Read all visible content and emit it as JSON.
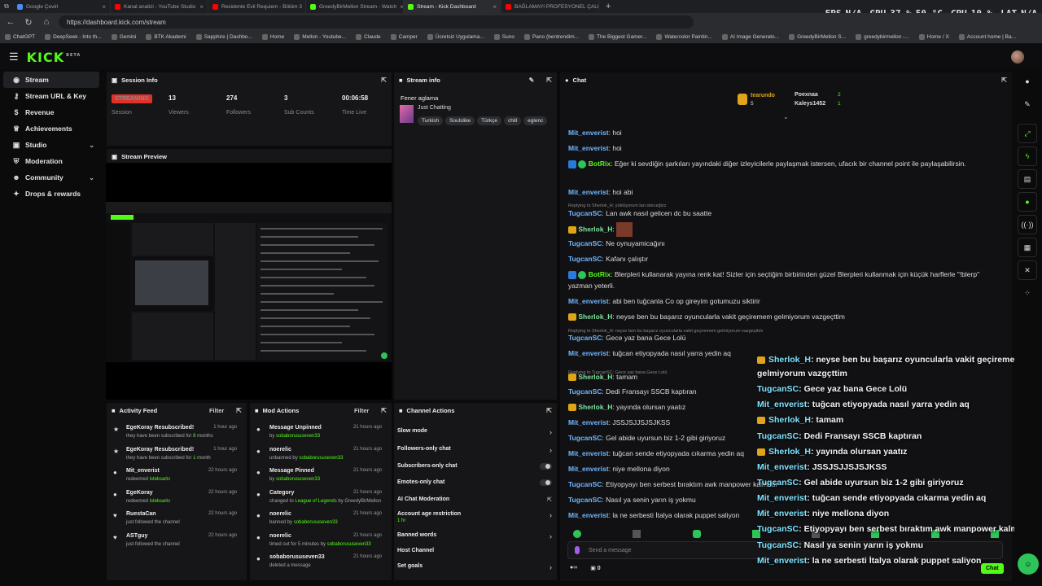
{
  "browser": {
    "tabs": [
      {
        "title": "Google Çeviri",
        "color": "#4a8cf7",
        "active": false
      },
      {
        "title": "Kanal analizi - YouTube Studio",
        "color": "#ff0000",
        "active": false
      },
      {
        "title": "Residente Evil Requiem - Bölüm 3",
        "color": "#ff0000",
        "active": false
      },
      {
        "title": "GreedyBirMellon Stream - Watch",
        "color": "#53fc18",
        "active": false
      },
      {
        "title": "Stream - Kick Dashboard",
        "color": "#53fc18",
        "active": true
      },
      {
        "title": "BAĞLAMAYI PROFESYONEL ÇALMAK",
        "color": "#ff0000",
        "active": false
      }
    ],
    "url": "https://dashboard.kick.com/stream",
    "bookmarks": [
      "ChatGPT",
      "DeepSeek - Into th...",
      "Gemini",
      "BTK Akademi",
      "Sapphire | Dashbo...",
      "Home",
      "Mellon - Youtube...",
      "Claude",
      "Camper",
      "Ücretsiz Uygulama...",
      "Suno",
      "Pano (bentrendim...",
      "The Biggest Gamer...",
      "Watercolor Paintin...",
      "AI Image Generato...",
      "GreedyBirMellon S...",
      "greedybirmellon -...",
      "Home / X",
      "Account home | Ba..."
    ]
  },
  "hud": {
    "fps_label": "FPS",
    "fps": "N/A",
    "gpu_label": "GPU",
    "gpu": "37 %",
    "gpu_temp": "50 °C",
    "cpu_label": "CPU",
    "cpu": "10 %",
    "lat_label": "LAT",
    "lat": "N/A"
  },
  "kick": {
    "logo": "KICK",
    "logo_sup": "BETA"
  },
  "sidebar": {
    "items": [
      {
        "label": "Stream",
        "icon": "broadcast-icon"
      },
      {
        "label": "Stream URL & Key",
        "icon": "key-icon"
      },
      {
        "label": "Revenue",
        "icon": "money-icon"
      },
      {
        "label": "Achievements",
        "icon": "trophy-icon"
      },
      {
        "label": "Studio",
        "icon": "studio-icon"
      },
      {
        "label": "Moderation",
        "icon": "shield-icon"
      },
      {
        "label": "Community",
        "icon": "people-icon"
      },
      {
        "label": "Drops & rewards",
        "icon": "gift-icon"
      }
    ]
  },
  "session": {
    "title": "Session Info",
    "status": "STREAMING",
    "status_label": "Session",
    "stats": [
      {
        "value": "13",
        "label": "Viewers"
      },
      {
        "value": "274",
        "label": "Followers"
      },
      {
        "value": "3",
        "label": "Sub Counts"
      },
      {
        "value": "00:06:58",
        "label": "Time Live"
      }
    ]
  },
  "stream_info": {
    "title": "Stream info",
    "stream_title": "Fener aglama",
    "category": "Just Chatting",
    "tags": [
      "Turkish",
      "Soulslike",
      "Türkçe",
      "chill",
      "eglenc"
    ]
  },
  "preview": {
    "title": "Stream Preview"
  },
  "activity": {
    "title": "Activity Feed",
    "filter": "Filter",
    "items": [
      {
        "title": "EgeKoray Resubscribed!",
        "sub": "they have been subscribed for ",
        "hl": "8",
        "sub2": " months",
        "time": "1 hour ago"
      },
      {
        "title": "EgeKoray Resubscribed!",
        "sub": "they have been subscribed for ",
        "hl": "1",
        "sub2": " month",
        "time": "1 hour ago"
      },
      {
        "title": "Mit_enverist",
        "sub": "redeemed ",
        "hl": "isteksarkı",
        "sub2": "",
        "time": "22 hours ago"
      },
      {
        "title": "EgeKoray",
        "sub": "redeemed ",
        "hl": "isteksarkı",
        "sub2": "",
        "time": "22 hours ago"
      },
      {
        "title": "RuestaCan",
        "sub": "just followed the channel",
        "hl": "",
        "sub2": "",
        "time": "22 hours ago"
      },
      {
        "title": "ASTguy",
        "sub": "just followed the channel",
        "hl": "",
        "sub2": "",
        "time": "22 hours ago"
      }
    ]
  },
  "mod_actions": {
    "title": "Mod Actions",
    "filter": "Filter",
    "items": [
      {
        "title": "Message Unpinned",
        "sub": "by ",
        "hl": "sobaborususeven33",
        "sub2": "",
        "time": "21 hours ago"
      },
      {
        "title": "noerelic",
        "sub": "unbanned by ",
        "hl": "sobaborususeven33",
        "sub2": "",
        "time": "21 hours ago"
      },
      {
        "title": "Message Pinned",
        "sub": "by ",
        "hl": "sobaborususeven33",
        "sub2": "",
        "time": "21 hours ago"
      },
      {
        "title": "Category",
        "sub": "changed to ",
        "hl": "League of Legends",
        "sub2": " by GreedyBirMellon",
        "time": "21 hours ago"
      },
      {
        "title": "noerelic",
        "sub": "banned by ",
        "hl": "sobaborususeven33",
        "sub2": "",
        "time": "21 hours ago"
      },
      {
        "title": "noerelic",
        "sub": "timed out for 5 minutes by ",
        "hl": "sobaborususeven33",
        "sub2": "",
        "time": "21 hours ago"
      },
      {
        "title": "sobaborususeven33",
        "sub": "deleted a message",
        "hl": "",
        "sub2": "",
        "time": "21 hours ago"
      }
    ]
  },
  "channel_actions": {
    "title": "Channel Actions",
    "items": [
      {
        "label": "Slow mode",
        "kind": "arrow"
      },
      {
        "label": "Followers-only chat",
        "kind": "arrow"
      },
      {
        "label": "Subscribers-only chat",
        "kind": "toggle"
      },
      {
        "label": "Emotes-only chat",
        "kind": "toggle"
      },
      {
        "label": "AI Chat Moderation",
        "kind": "ext"
      },
      {
        "label": "Account age restriction",
        "kind": "arrow",
        "sub": "1 hr"
      },
      {
        "label": "Banned words",
        "kind": "arrow"
      },
      {
        "label": "Host Channel",
        "kind": "none"
      },
      {
        "label": "Set goals",
        "kind": "arrow"
      }
    ]
  },
  "chat": {
    "title": "Chat",
    "leaderboard": [
      {
        "name": "tearundo",
        "count": "5"
      },
      {
        "name": "Poexnaa",
        "count": "2"
      },
      {
        "name": "Kaleys1452",
        "count": "1"
      }
    ],
    "messages": [
      {
        "user": "Mit_enverist",
        "color": "#6fb7ff",
        "text": "hoi",
        "badge": ""
      },
      {
        "user": "Mit_enverist",
        "color": "#6fb7ff",
        "text": "hoi",
        "badge": ""
      },
      {
        "user": "BotRix",
        "color": "#53fc18",
        "text": "Eğer ki sevdiğin şarkıları yayındaki diğer izleyicilerle paylaşmak istersen, ufacık bir channel point ile paylaşabilirsin.",
        "badge": "bot"
      },
      {
        "user": "Mit_enverist",
        "color": "#6fb7ff",
        "text": "hoi abi",
        "badge": ""
      },
      {
        "reply": "Replying to Sherlok_H: yüklüyorum lan siteceğizz"
      },
      {
        "user": "TugcanSC",
        "color": "#6fb7ff",
        "text": "Lan awk nasıl gelicen dc bu saatte",
        "badge": ""
      },
      {
        "user": "Sherlok_H",
        "color": "#7fe3a0",
        "text": "",
        "badge": "crown"
      },
      {
        "user": "TugcanSC",
        "color": "#6fb7ff",
        "text": "Ne oynuyamicağını",
        "badge": ""
      },
      {
        "user": "TugcanSC",
        "color": "#6fb7ff",
        "text": "Kafanı çalıştır",
        "badge": ""
      },
      {
        "user": "BotRix",
        "color": "#53fc18",
        "text": "Blerpleri kullanarak yayına renk kat! Sizler için seçtiğim birbirinden güzel Blerpleri kullanmak için küçük harflerle \"!blerp\" yazman yeterli.",
        "badge": "bot"
      },
      {
        "user": "Mit_enverist",
        "color": "#6fb7ff",
        "text": "abi ben tuğcanla Co op gireyim gotumuzu siktirir",
        "badge": ""
      },
      {
        "user": "Sherlok_H",
        "color": "#7fe3a0",
        "text": "neyse ben bu başarız oyuncularla vakit geçiremem gelmiyorum vazgeçttim",
        "badge": "crown"
      },
      {
        "reply": "Replying to Sherlok_H: neyse ben bu başarız oyuncularla vakit geçiremem gelmiyorum vazgeçttim"
      },
      {
        "user": "TugcanSC",
        "color": "#6fb7ff",
        "text": "Gece yaz bana Gece Lolü",
        "badge": ""
      },
      {
        "user": "Mit_enverist",
        "color": "#6fb7ff",
        "text": "tuğcan etiyopyada nasıl yarra yedin aq",
        "badge": ""
      },
      {
        "reply": "Replying to TugcanSC: Gece yaz bana Gece Lolü"
      },
      {
        "user": "Sherlok_H",
        "color": "#7fe3a0",
        "text": "tamam",
        "badge": "crown"
      },
      {
        "user": "TugcanSC",
        "color": "#6fb7ff",
        "text": "Dedi Fransayı SSCB kaptıran",
        "badge": ""
      },
      {
        "user": "Sherlok_H",
        "color": "#7fe3a0",
        "text": "yayında olursan yaatız",
        "badge": "crown"
      },
      {
        "user": "Mit_enverist",
        "color": "#6fb7ff",
        "text": "JSSJSJJSJSJKSS",
        "badge": ""
      },
      {
        "user": "TugcanSC",
        "color": "#6fb7ff",
        "text": "Gel abide uyursun biz 1-2 gibi giriyoruz",
        "badge": ""
      },
      {
        "user": "Mit_enverist",
        "color": "#6fb7ff",
        "text": "tuğcan sende etiyopyada cıkarma yedin aq",
        "badge": ""
      },
      {
        "user": "Mit_enverist",
        "color": "#6fb7ff",
        "text": "niye mellona diyon",
        "badge": ""
      },
      {
        "user": "TugcanSC",
        "color": "#6fb7ff",
        "text": "Etiyopyayı ben serbest bıraktım awk manpower kalmadı",
        "badge": ""
      },
      {
        "user": "TugcanSC",
        "color": "#6fb7ff",
        "text": "Nasıl ya senin yarın iş yokmu",
        "badge": ""
      },
      {
        "user": "Mit_enverist",
        "color": "#6fb7ff",
        "text": "la ne serbesti İtalya olarak puppet saliyon",
        "badge": ""
      }
    ],
    "placeholder": "Send a message",
    "points": "0",
    "send": "Chat"
  },
  "overlay": [
    {
      "user": "Sherlok_H",
      "text": ": neyse ben bu başarız oyuncularla vakit geçiremem",
      "crown": true
    },
    {
      "user": "",
      "text": "gelmiyorum vazgçttim",
      "crown": false
    },
    {
      "user": "TugcanSC",
      "text": ": Gece yaz bana Gece Lolü",
      "crown": false
    },
    {
      "user": "Mit_enverist",
      "text": ": tuğcan etiyopyada nasıl yarra yedin aq",
      "crown": false
    },
    {
      "user": "Sherlok_H",
      "text": ": tamam",
      "crown": true
    },
    {
      "user": "TugcanSC",
      "text": ": Dedi Fransayı SSCB kaptıran",
      "crown": false
    },
    {
      "user": "Sherlok_H",
      "text": ": yayında olursan yaatız",
      "crown": true
    },
    {
      "user": "Mit_enverist",
      "text": ": JSSJSJJSJSJKSS",
      "crown": false
    },
    {
      "user": "TugcanSC",
      "text": ": Gel abide uyursun biz 1-2 gibi giriyoruz",
      "crown": false
    },
    {
      "user": "Mit_enverist",
      "text": ": tuğcan sende etiyopyada cıkarma yedin aq",
      "crown": false
    },
    {
      "user": "Mit_enverist",
      "text": ": niye mellona diyon",
      "crown": false
    },
    {
      "user": "TugcanSC",
      "text": ": Etiyopyayı ben serbest bıraktım awk manpower kalmadı",
      "crown": false
    },
    {
      "user": "TugcanSC",
      "text": ": Nasıl ya senin yarın iş yokmu",
      "crown": false
    },
    {
      "user": "Mit_enverist",
      "text": ": la ne serbesti İtalya olarak puppet saliyon",
      "crown": false
    }
  ]
}
